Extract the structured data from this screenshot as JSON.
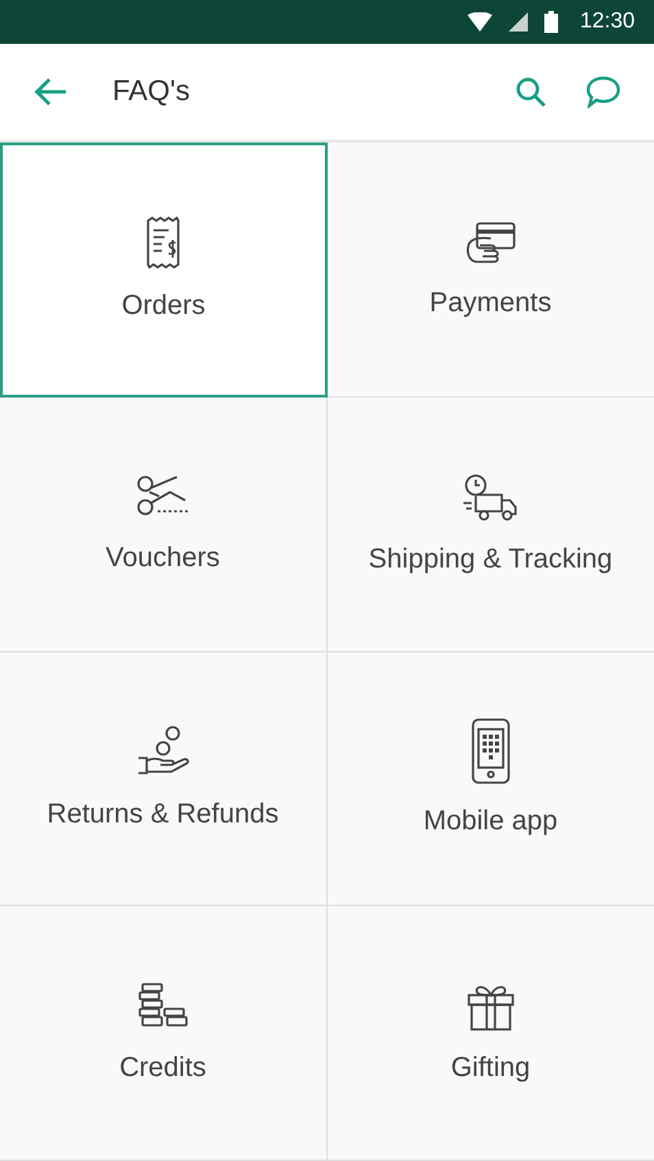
{
  "status_bar": {
    "time": "12:30"
  },
  "header": {
    "title": "FAQ's"
  },
  "categories": [
    {
      "label": "Orders",
      "selected": true
    },
    {
      "label": "Payments",
      "selected": false
    },
    {
      "label": "Vouchers",
      "selected": false
    },
    {
      "label": "Shipping & Tracking",
      "selected": false
    },
    {
      "label": "Returns & Refunds",
      "selected": false
    },
    {
      "label": "Mobile app",
      "selected": false
    },
    {
      "label": "Credits",
      "selected": false
    },
    {
      "label": "Gifting",
      "selected": false
    }
  ]
}
